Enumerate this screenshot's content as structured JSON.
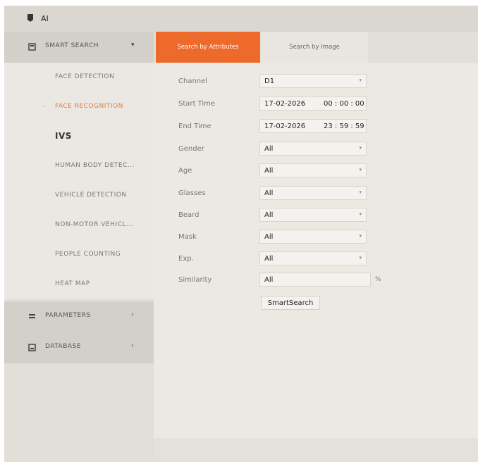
{
  "app": {
    "title": "AI"
  },
  "sidebar": {
    "smart_search": {
      "label": "SMART SEARCH",
      "arrow": "▾"
    },
    "items": [
      {
        "label": "FACE DETECTION"
      },
      {
        "label": "FACE RECOGNITION",
        "marker": "-"
      },
      {
        "label": "IVS"
      },
      {
        "label": "HUMAN BODY DETEC..."
      },
      {
        "label": "VEHICLE DETECTION"
      },
      {
        "label": "NON-MOTOR VEHICL..."
      },
      {
        "label": "PEOPLE COUNTING"
      },
      {
        "label": "HEAT MAP"
      }
    ],
    "parameters": {
      "label": "PARAMETERS",
      "arrow": "›"
    },
    "database": {
      "label": "DATABASE",
      "arrow": "›"
    }
  },
  "tabs": [
    {
      "label": "Search by Attributes",
      "active": true
    },
    {
      "label": "Search by Image",
      "active": false
    }
  ],
  "form": {
    "channel": {
      "label": "Channel",
      "value": "D1"
    },
    "start_time": {
      "label": "Start Time",
      "date": "17-02-2026",
      "time": "00 : 00 : 00"
    },
    "end_time": {
      "label": "End Time",
      "date": "17-02-2026",
      "time": "23 : 59 : 59"
    },
    "gender": {
      "label": "Gender",
      "value": "All"
    },
    "age": {
      "label": "Age",
      "value": "All"
    },
    "glasses": {
      "label": "Glasses",
      "value": "All"
    },
    "beard": {
      "label": "Beard",
      "value": "All"
    },
    "mask": {
      "label": "Mask",
      "value": "All"
    },
    "expression": {
      "label": "Exp.",
      "value": "All"
    },
    "similarity": {
      "label": "Similarity",
      "value": "All",
      "unit": "%"
    },
    "search_button": "SmartSearch"
  },
  "icons": {
    "dropdown": "▾"
  },
  "colors": {
    "accent": "#ee6a2a",
    "active_text": "#e2793a"
  }
}
